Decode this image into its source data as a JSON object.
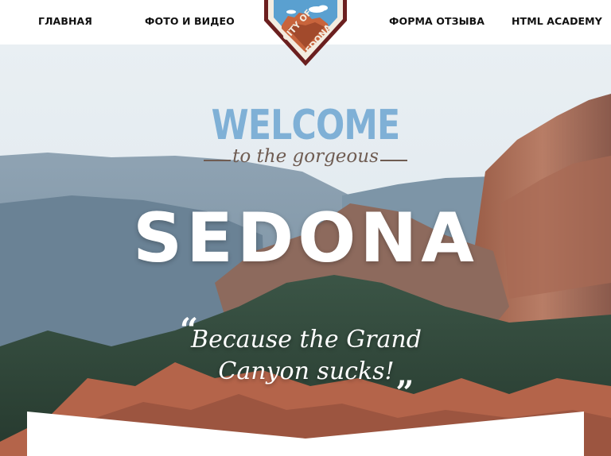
{
  "nav": {
    "items": [
      {
        "label": "ГЛАВНАЯ"
      },
      {
        "label": "ФОТО И ВИДЕО"
      },
      {
        "label": "ФОРМА ОТЗЫВА"
      },
      {
        "label": "HTML ACADEMY"
      }
    ]
  },
  "logo": {
    "line1": "CITY OF",
    "line2": "SEDONA",
    "colors": {
      "frame": "#6b1f1f",
      "sky": "#5aa0d0",
      "rock": "#c8643c"
    }
  },
  "hero": {
    "welcome": "WELCOME",
    "tagline": "to the gorgeous",
    "city": "SEDONA",
    "quote_open": "“",
    "quote": "Because the Grand Canyon sucks!",
    "quote_close": "„",
    "colors": {
      "welcome": "#7fb0d6",
      "tagline": "#6f5c52",
      "sky": "#e6edf2",
      "forest": "#2f4a3a",
      "rock": "#b06a4e"
    }
  }
}
